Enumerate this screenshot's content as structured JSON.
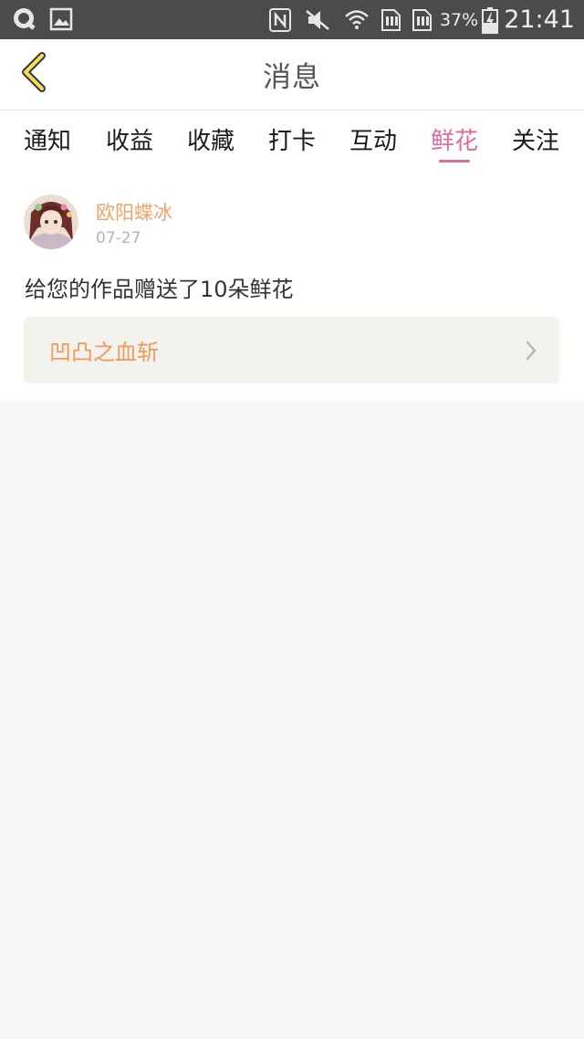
{
  "status_bar": {
    "battery_percent": "37%",
    "time": "21:41",
    "icons": [
      "q-app-icon",
      "gallery-icon",
      "nfc-icon",
      "mute-icon",
      "wifi-icon",
      "sim1-icon",
      "sim2-icon",
      "battery-charging-icon"
    ]
  },
  "header": {
    "title": "消息",
    "back_icon": "chevron-left-icon"
  },
  "tabs": {
    "items": [
      {
        "label": "通知"
      },
      {
        "label": "收益"
      },
      {
        "label": "收藏"
      },
      {
        "label": "打卡"
      },
      {
        "label": "互动"
      },
      {
        "label": "鲜花"
      },
      {
        "label": "关注"
      }
    ],
    "active_index": 5,
    "active_color": "#e06a9c"
  },
  "message": {
    "username": "欧阳蝶冰",
    "date": "07-27",
    "text": "给您的作品赠送了10朵鲜花",
    "work_title": "凹凸之血斩",
    "accent_color": "#f0a36a"
  }
}
